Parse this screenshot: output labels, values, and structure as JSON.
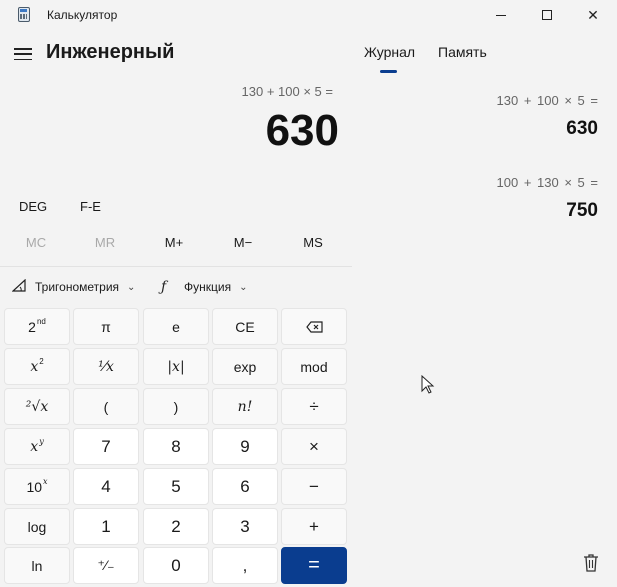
{
  "window": {
    "title": "Калькулятор",
    "minimize_label": "",
    "maximize_label": "",
    "close_label": "✕"
  },
  "header": {
    "mode_title": "Инженерный"
  },
  "display": {
    "expression": "130 + 100 × 5 =",
    "result": "630"
  },
  "modes": {
    "angle": "DEG",
    "notation": "F-E"
  },
  "memory": {
    "buttons": [
      {
        "label": "MC",
        "enabled": false
      },
      {
        "label": "MR",
        "enabled": false
      },
      {
        "label": "M+",
        "enabled": true
      },
      {
        "label": "M−",
        "enabled": true
      },
      {
        "label": "MS",
        "enabled": true
      }
    ]
  },
  "functions": {
    "trig_label": "Тригонометрия",
    "func_label": "Функция"
  },
  "keys": {
    "second": "2",
    "second_sup": "nd",
    "pi": "π",
    "e": "e",
    "ce": "CE",
    "backspace": "⌫",
    "square": "x",
    "square_sup": "2",
    "reciprocal": "¹⁄x",
    "abs": "|x|",
    "exp": "exp",
    "mod": "mod",
    "sqrt": "²√x",
    "lparen": "(",
    "rparen": ")",
    "factorial": "n!",
    "divide": "÷",
    "power": "x",
    "power_sup": "y",
    "seven": "7",
    "eight": "8",
    "nine": "9",
    "multiply": "×",
    "tenpow": "10",
    "tenpow_sup": "x",
    "four": "4",
    "five": "5",
    "six": "6",
    "minus": "−",
    "log": "log",
    "one": "1",
    "two": "2",
    "three": "3",
    "plus": "+",
    "ln": "ln",
    "negate": "⁺⁄₋",
    "zero": "0",
    "decimal": ",",
    "equals": "="
  },
  "history_panel": {
    "tabs": [
      "Журнал",
      "Память"
    ],
    "active_tab": "Журнал",
    "entries": [
      {
        "expression": "130 + 100 × 5 =",
        "result": "630"
      },
      {
        "expression": "100 + 130 × 5 =",
        "result": "750"
      }
    ]
  },
  "colors": {
    "accent": "#0a3d8f",
    "background": "#f3f3f3",
    "key_number": "#ffffff",
    "key_function": "#f9f9f9"
  },
  "icons": [
    "calculator-app-icon",
    "hamburger-icon",
    "backspace-icon",
    "trig-icon",
    "function-icon",
    "chevron-down-icon",
    "trash-icon",
    "mouse-cursor-icon"
  ]
}
